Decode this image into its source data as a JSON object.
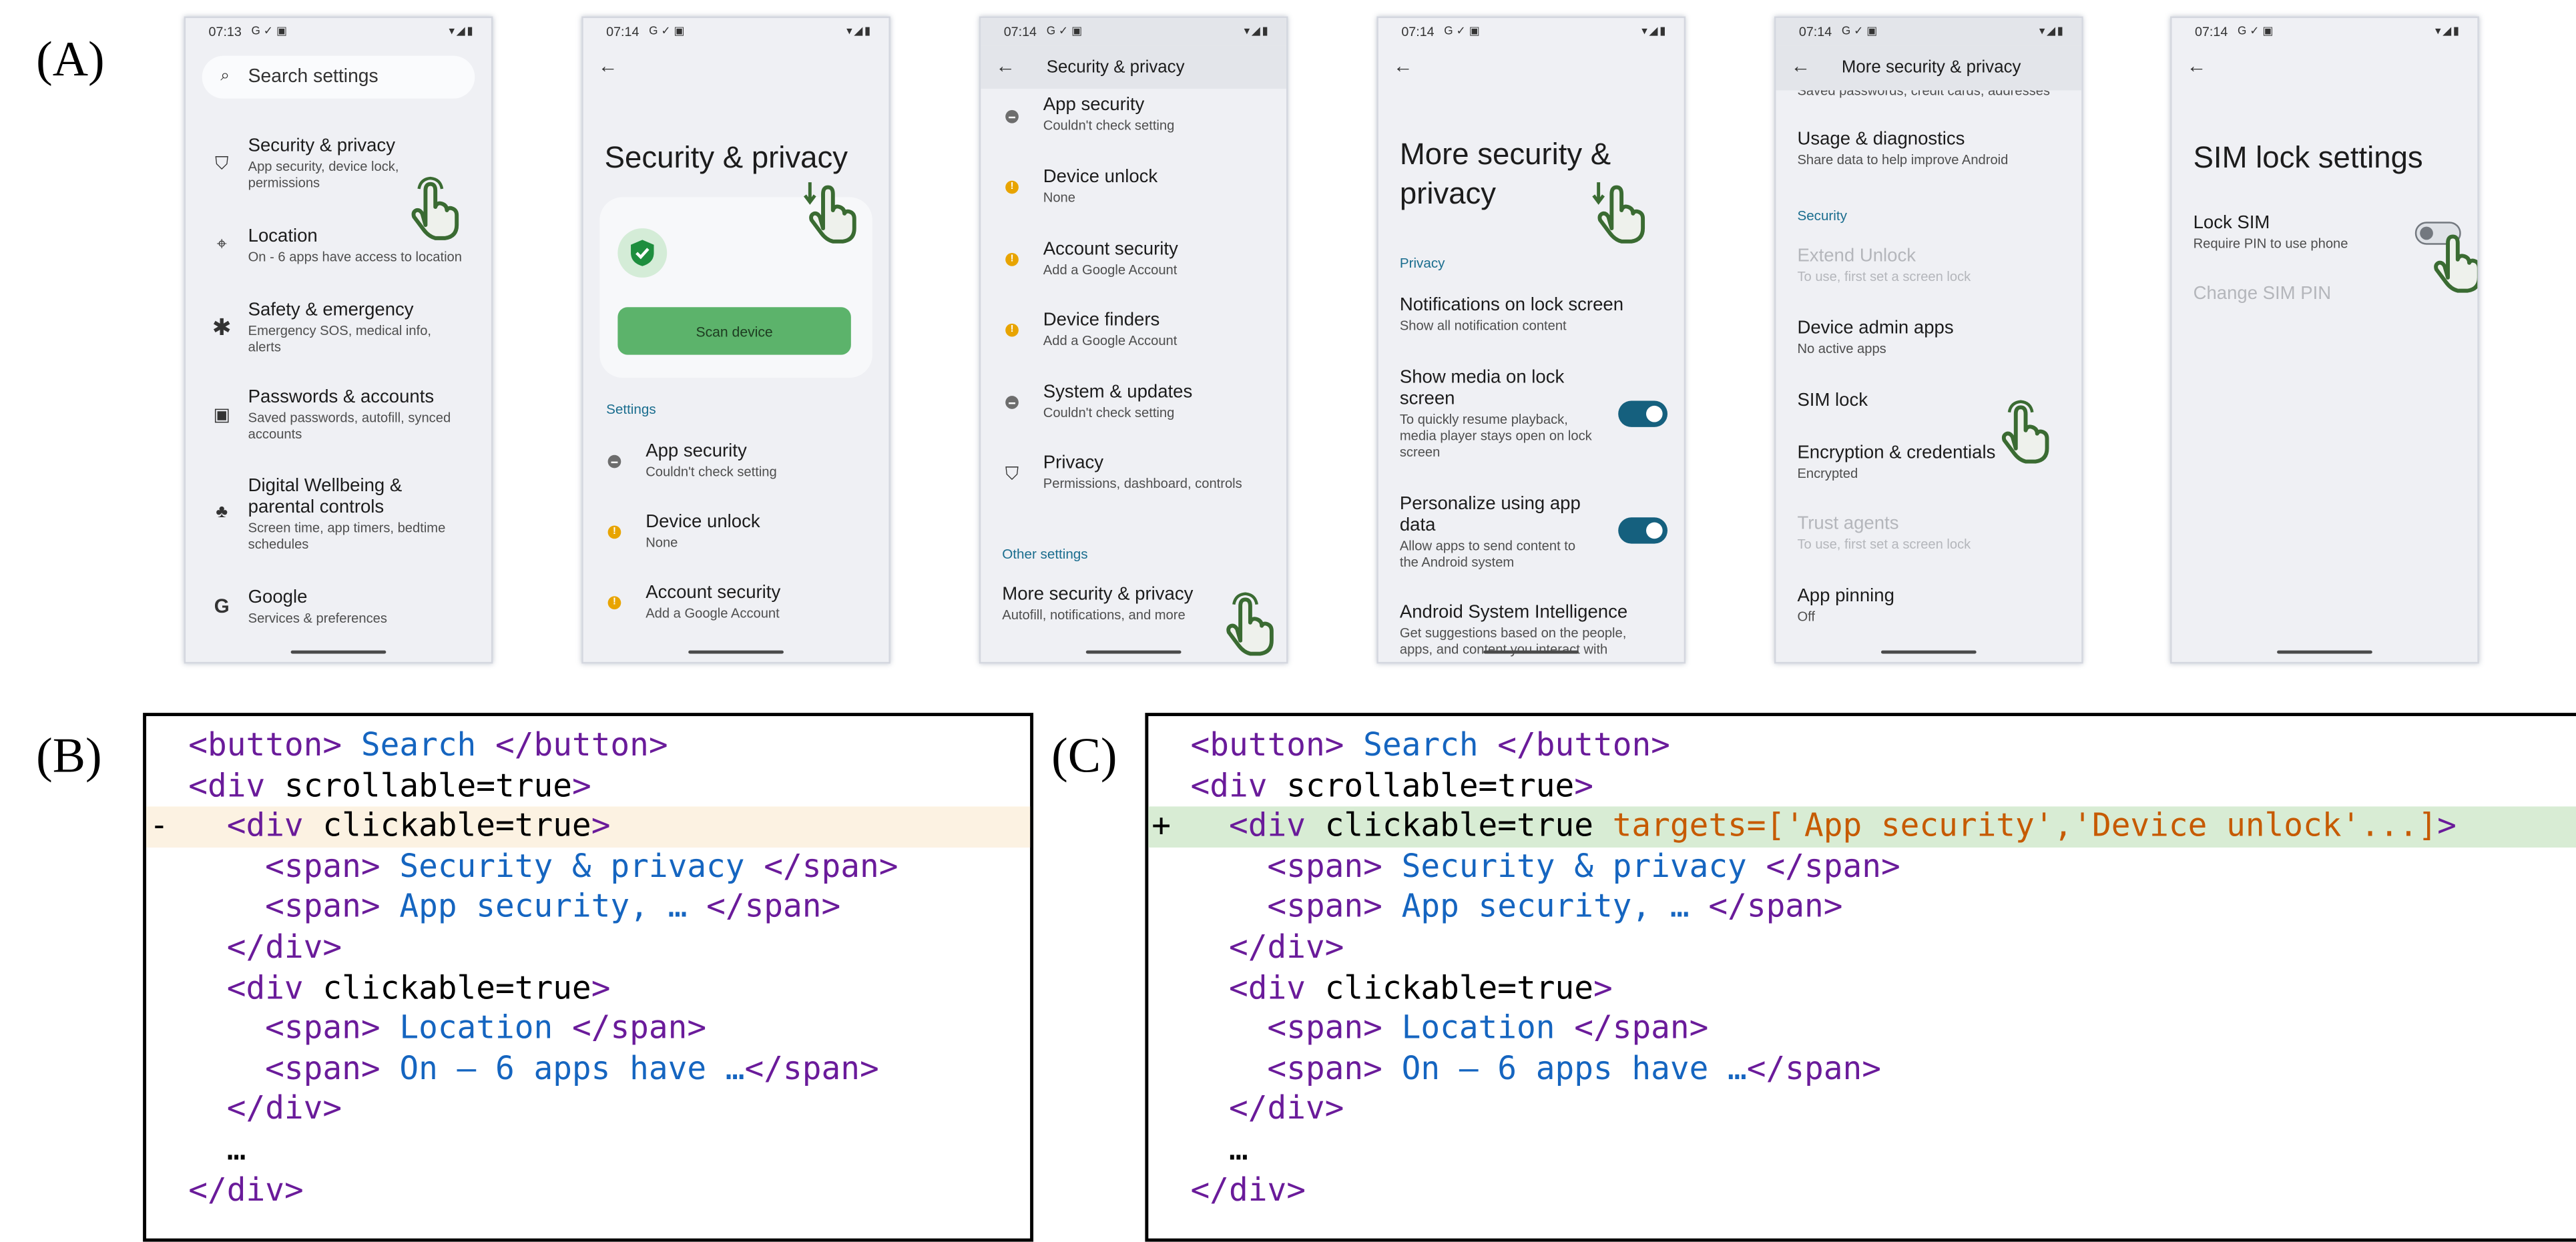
{
  "labels": {
    "a": "(A)",
    "b": "(B)",
    "c": "(C)"
  },
  "colors": {
    "accent_teal": "#1a6d8e",
    "toggle_on": "#15607e",
    "button_green": "#5cb36b",
    "hand_green": "#3a6b32",
    "warn": "#e8a400",
    "diff_removed_bg": "#fcf2e2",
    "diff_added_bg": "#d8ecd4",
    "tag_purple": "#6a1b9a",
    "text_blue": "#1565c0",
    "attr_orange": "#c65a00"
  },
  "screens": [
    {
      "time": "07:13",
      "status_left": "G ✓ ▣",
      "status_right": "▾◢▮",
      "search_placeholder": "Search settings",
      "items": [
        {
          "icon": "shield-icon",
          "title": "Security & privacy",
          "sub": "App security, device lock,\npermissions"
        },
        {
          "icon": "location-pin-icon",
          "title": "Location",
          "sub": "On - 6 apps have access to location"
        },
        {
          "icon": "asterisk-icon",
          "title": "Safety & emergency",
          "sub": "Emergency SOS, medical info,\nalerts"
        },
        {
          "icon": "account-box-icon",
          "title": "Passwords & accounts",
          "sub": "Saved passwords, autofill, synced\naccounts"
        },
        {
          "icon": "wellbeing-icon",
          "title": "Digital Wellbeing &\nparental controls",
          "sub": "Screen time, app timers, bedtime\nschedules"
        },
        {
          "icon": "google-g-icon",
          "title": "Google",
          "sub": "Services & preferences"
        }
      ]
    },
    {
      "time": "07:14",
      "status_left": "G ✓ ▣",
      "status_right": "▾◢▮",
      "title": "Security & privacy",
      "scan_button": "Scan device",
      "section": "Settings",
      "items": [
        {
          "icon": "minus-circle-icon",
          "title": "App security",
          "sub": "Couldn't check setting"
        },
        {
          "icon": "warning-circle-icon",
          "title": "Device unlock",
          "sub": "None"
        },
        {
          "icon": "warning-circle-icon",
          "title": "Account security",
          "sub": "Add a Google Account"
        }
      ]
    },
    {
      "time": "07:14",
      "status_left": "G ✓ ▣",
      "status_right": "▾◢▮",
      "toolbar_title": "Security & privacy",
      "items": [
        {
          "icon": "minus-circle-icon",
          "title": "App security",
          "sub": "Couldn't check setting"
        },
        {
          "icon": "warning-circle-icon",
          "title": "Device unlock",
          "sub": "None"
        },
        {
          "icon": "warning-circle-icon",
          "title": "Account security",
          "sub": "Add a Google Account"
        },
        {
          "icon": "warning-circle-icon",
          "title": "Device finders",
          "sub": "Add a Google Account"
        },
        {
          "icon": "minus-circle-icon",
          "title": "System & updates",
          "sub": "Couldn't check setting"
        },
        {
          "icon": "shield-icon",
          "title": "Privacy",
          "sub": "Permissions, dashboard, controls"
        }
      ],
      "section": "Other settings",
      "more": {
        "title": "More security & privacy",
        "sub": "Autofill, notifications, and more"
      }
    },
    {
      "time": "07:14",
      "status_left": "G ✓ ▣",
      "status_right": "▾◢▮",
      "title": "More security &\nprivacy",
      "section": "Privacy",
      "items": [
        {
          "title": "Notifications on lock screen",
          "sub": "Show all notification content"
        },
        {
          "title": "Show media on lock\nscreen",
          "sub": "To quickly resume playback,\nmedia player stays open on lock\nscreen",
          "toggle": true
        },
        {
          "title": "Personalize using app\ndata",
          "sub": "Allow apps to send content to\nthe Android system",
          "toggle": true
        },
        {
          "title": "Android System Intelligence",
          "sub": "Get suggestions based on the people,\napps, and content you interact with"
        }
      ]
    },
    {
      "time": "07:14",
      "status_left": "G ✓ ▣",
      "status_right": "▾◢▮",
      "toolbar_title": "More security & privacy",
      "cut_text": "Saved passwords, credit cards, addresses",
      "items_top": [
        {
          "title": "Usage & diagnostics",
          "sub": "Share data to help improve Android"
        }
      ],
      "section": "Security",
      "items": [
        {
          "title": "Extend Unlock",
          "sub": "To use, first set a screen lock",
          "disabled": true
        },
        {
          "title": "Device admin apps",
          "sub": "No active apps"
        },
        {
          "title": "SIM lock",
          "sub": ""
        },
        {
          "title": "Encryption & credentials",
          "sub": "Encrypted"
        },
        {
          "title": "Trust agents",
          "sub": "To use, first set a screen lock",
          "disabled": true
        },
        {
          "title": "App pinning",
          "sub": "Off"
        }
      ]
    },
    {
      "time": "07:14",
      "status_left": "G ✓ ▣",
      "status_right": "▾◢▮",
      "title": "SIM lock settings",
      "items": [
        {
          "title": "Lock SIM",
          "sub": "Require PIN to use phone",
          "toggle_off": true
        },
        {
          "title": "Change SIM PIN",
          "disabled": true
        }
      ]
    }
  ],
  "code_b": [
    {
      "prefix": " ",
      "indent": "",
      "parts": [
        [
          "tg",
          "<"
        ],
        [
          "tg",
          "button"
        ],
        [
          "tg",
          "> "
        ],
        [
          "tx",
          "Search"
        ],
        [
          "tg",
          " </"
        ],
        [
          "tg",
          "button"
        ],
        [
          "tg",
          ">"
        ]
      ]
    },
    {
      "prefix": " ",
      "indent": "",
      "parts": [
        [
          "tg",
          "<"
        ],
        [
          "tg",
          "div"
        ],
        [
          "",
          " scrollable=true"
        ],
        [
          "tg",
          ">"
        ]
      ]
    },
    {
      "prefix": "-",
      "indent": "  ",
      "hl": "del",
      "parts": [
        [
          "tg",
          "<"
        ],
        [
          "tg",
          "div"
        ],
        [
          "",
          " clickable=true"
        ],
        [
          "tg",
          ">"
        ]
      ]
    },
    {
      "prefix": " ",
      "indent": "    ",
      "parts": [
        [
          "tg",
          "<"
        ],
        [
          "tg",
          "span"
        ],
        [
          "tg",
          "> "
        ],
        [
          "tx",
          "Security & privacy"
        ],
        [
          "tg",
          " </"
        ],
        [
          "tg",
          "span"
        ],
        [
          "tg",
          ">"
        ]
      ]
    },
    {
      "prefix": " ",
      "indent": "    ",
      "parts": [
        [
          "tg",
          "<"
        ],
        [
          "tg",
          "span"
        ],
        [
          "tg",
          "> "
        ],
        [
          "tx",
          "App security, …"
        ],
        [
          "tg",
          " </"
        ],
        [
          "tg",
          "span"
        ],
        [
          "tg",
          ">"
        ]
      ]
    },
    {
      "prefix": " ",
      "indent": "  ",
      "parts": [
        [
          "tg",
          "</"
        ],
        [
          "tg",
          "div"
        ],
        [
          "tg",
          ">"
        ]
      ]
    },
    {
      "prefix": " ",
      "indent": "  ",
      "parts": [
        [
          "tg",
          "<"
        ],
        [
          "tg",
          "div"
        ],
        [
          "",
          " clickable=true"
        ],
        [
          "tg",
          ">"
        ]
      ]
    },
    {
      "prefix": " ",
      "indent": "    ",
      "parts": [
        [
          "tg",
          "<"
        ],
        [
          "tg",
          "span"
        ],
        [
          "tg",
          "> "
        ],
        [
          "tx",
          "Location"
        ],
        [
          "tg",
          " </"
        ],
        [
          "tg",
          "span"
        ],
        [
          "tg",
          ">"
        ]
      ]
    },
    {
      "prefix": " ",
      "indent": "    ",
      "parts": [
        [
          "tg",
          "<"
        ],
        [
          "tg",
          "span"
        ],
        [
          "tg",
          "> "
        ],
        [
          "tx",
          "On – 6 apps have …"
        ],
        [
          "tg",
          "</"
        ],
        [
          "tg",
          "span"
        ],
        [
          "tg",
          ">"
        ]
      ]
    },
    {
      "prefix": " ",
      "indent": "  ",
      "parts": [
        [
          "tg",
          "</"
        ],
        [
          "tg",
          "div"
        ],
        [
          "tg",
          ">"
        ]
      ]
    },
    {
      "prefix": " ",
      "indent": "  ",
      "parts": [
        [
          "",
          "…"
        ]
      ]
    },
    {
      "prefix": " ",
      "indent": "",
      "parts": [
        [
          "tg",
          "</"
        ],
        [
          "tg",
          "div"
        ],
        [
          "tg",
          ">"
        ]
      ]
    }
  ],
  "code_c": [
    {
      "prefix": " ",
      "indent": "",
      "parts": [
        [
          "tg",
          "<"
        ],
        [
          "tg",
          "button"
        ],
        [
          "tg",
          "> "
        ],
        [
          "tx",
          "Search"
        ],
        [
          "tg",
          " </"
        ],
        [
          "tg",
          "button"
        ],
        [
          "tg",
          ">"
        ]
      ]
    },
    {
      "prefix": " ",
      "indent": "",
      "parts": [
        [
          "tg",
          "<"
        ],
        [
          "tg",
          "div"
        ],
        [
          "",
          " scrollable=true"
        ],
        [
          "tg",
          ">"
        ]
      ]
    },
    {
      "prefix": "+",
      "indent": "  ",
      "hl": "add",
      "parts": [
        [
          "tg",
          "<"
        ],
        [
          "tg",
          "div"
        ],
        [
          "",
          " clickable=true "
        ],
        [
          "or",
          "targets=['App security','Device unlock'...]"
        ],
        [
          "tg",
          ">"
        ]
      ]
    },
    {
      "prefix": " ",
      "indent": "    ",
      "parts": [
        [
          "tg",
          "<"
        ],
        [
          "tg",
          "span"
        ],
        [
          "tg",
          "> "
        ],
        [
          "tx",
          "Security & privacy"
        ],
        [
          "tg",
          " </"
        ],
        [
          "tg",
          "span"
        ],
        [
          "tg",
          ">"
        ]
      ]
    },
    {
      "prefix": " ",
      "indent": "    ",
      "parts": [
        [
          "tg",
          "<"
        ],
        [
          "tg",
          "span"
        ],
        [
          "tg",
          "> "
        ],
        [
          "tx",
          "App security, …"
        ],
        [
          "tg",
          " </"
        ],
        [
          "tg",
          "span"
        ],
        [
          "tg",
          ">"
        ]
      ]
    },
    {
      "prefix": " ",
      "indent": "  ",
      "parts": [
        [
          "tg",
          "</"
        ],
        [
          "tg",
          "div"
        ],
        [
          "tg",
          ">"
        ]
      ]
    },
    {
      "prefix": " ",
      "indent": "  ",
      "parts": [
        [
          "tg",
          "<"
        ],
        [
          "tg",
          "div"
        ],
        [
          "",
          " clickable=true"
        ],
        [
          "tg",
          ">"
        ]
      ]
    },
    {
      "prefix": " ",
      "indent": "    ",
      "parts": [
        [
          "tg",
          "<"
        ],
        [
          "tg",
          "span"
        ],
        [
          "tg",
          "> "
        ],
        [
          "tx",
          "Location"
        ],
        [
          "tg",
          " </"
        ],
        [
          "tg",
          "span"
        ],
        [
          "tg",
          ">"
        ]
      ]
    },
    {
      "prefix": " ",
      "indent": "    ",
      "parts": [
        [
          "tg",
          "<"
        ],
        [
          "tg",
          "span"
        ],
        [
          "tg",
          "> "
        ],
        [
          "tx",
          "On – 6 apps have …"
        ],
        [
          "tg",
          "</"
        ],
        [
          "tg",
          "span"
        ],
        [
          "tg",
          ">"
        ]
      ]
    },
    {
      "prefix": " ",
      "indent": "  ",
      "parts": [
        [
          "tg",
          "</"
        ],
        [
          "tg",
          "div"
        ],
        [
          "tg",
          ">"
        ]
      ]
    },
    {
      "prefix": " ",
      "indent": "  ",
      "parts": [
        [
          "",
          "…"
        ]
      ]
    },
    {
      "prefix": " ",
      "indent": "",
      "parts": [
        [
          "tg",
          "</"
        ],
        [
          "tg",
          "div"
        ],
        [
          "tg",
          ">"
        ]
      ]
    }
  ]
}
